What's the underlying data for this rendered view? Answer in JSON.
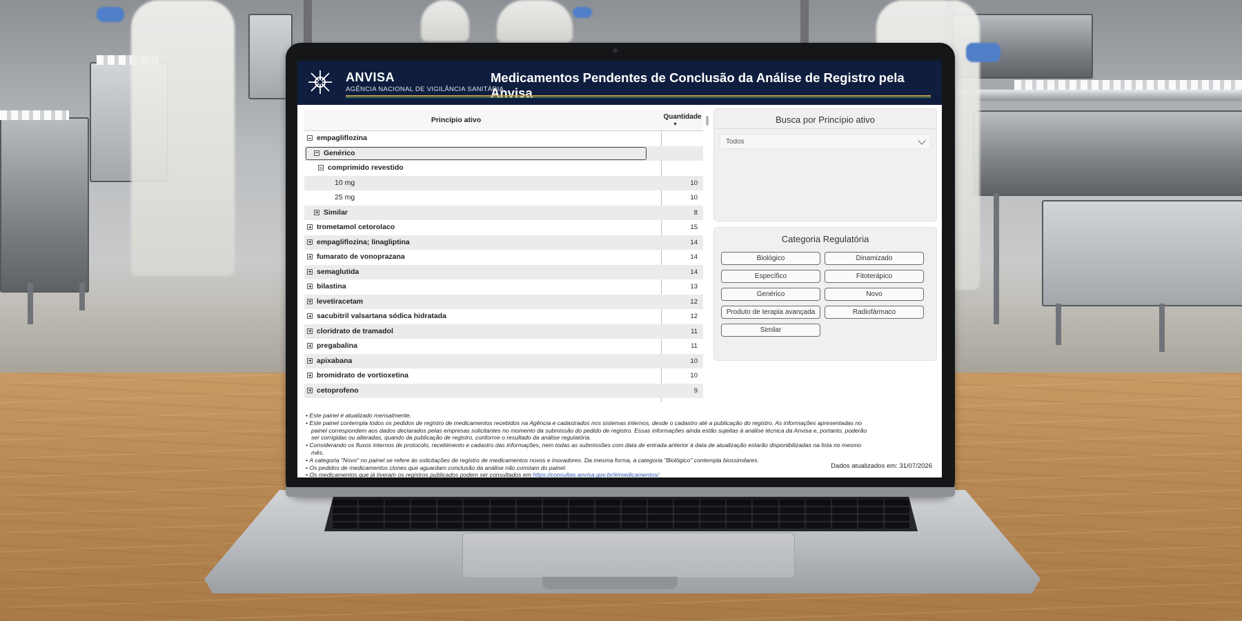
{
  "header": {
    "brand": "ANVISA",
    "agency": "AGÊNCIA NACIONAL DE VIGILÂNCIA SANITÁRIA",
    "title": "Medicamentos Pendentes de Conclusão da Análise de Registro pela Anvisa"
  },
  "table": {
    "col_principio": "Princípio ativo",
    "col_quantidade": "Quantidade",
    "rows": [
      {
        "label": "empagliflozina",
        "qty": "",
        "level": 0,
        "toggle": "minus",
        "bold": true
      },
      {
        "label": "Genérico",
        "qty": "",
        "level": 1,
        "toggle": "minus",
        "bold": true,
        "selected": true
      },
      {
        "label": "comprimido revestido",
        "qty": "",
        "level": 2,
        "toggle": "minus",
        "bold": true
      },
      {
        "label": "10 mg",
        "qty": "10",
        "level": 3,
        "toggle": "",
        "bold": false
      },
      {
        "label": "25 mg",
        "qty": "10",
        "level": 3,
        "toggle": "",
        "bold": false
      },
      {
        "label": "Similar",
        "qty": "8",
        "level": 1,
        "toggle": "plus",
        "bold": true
      },
      {
        "label": "trometamol cetorolaco",
        "qty": "15",
        "level": 0,
        "toggle": "plus",
        "bold": true
      },
      {
        "label": "empagliflozina; linagliptina",
        "qty": "14",
        "level": 0,
        "toggle": "plus",
        "bold": true
      },
      {
        "label": "fumarato de vonoprazana",
        "qty": "14",
        "level": 0,
        "toggle": "plus",
        "bold": true
      },
      {
        "label": "semaglutida",
        "qty": "14",
        "level": 0,
        "toggle": "plus",
        "bold": true
      },
      {
        "label": "bilastina",
        "qty": "13",
        "level": 0,
        "toggle": "plus",
        "bold": true
      },
      {
        "label": "levetiracetam",
        "qty": "12",
        "level": 0,
        "toggle": "plus",
        "bold": true
      },
      {
        "label": "sacubitril valsartana sódica hidratada",
        "qty": "12",
        "level": 0,
        "toggle": "plus",
        "bold": true
      },
      {
        "label": "cloridrato de tramadol",
        "qty": "11",
        "level": 0,
        "toggle": "plus",
        "bold": true
      },
      {
        "label": "pregabalina",
        "qty": "11",
        "level": 0,
        "toggle": "plus",
        "bold": true
      },
      {
        "label": "apixabana",
        "qty": "10",
        "level": 0,
        "toggle": "plus",
        "bold": true
      },
      {
        "label": "bromidrato de vortioxetina",
        "qty": "10",
        "level": 0,
        "toggle": "plus",
        "bold": true
      },
      {
        "label": "cetoprofeno",
        "qty": "9",
        "level": 0,
        "toggle": "plus",
        "bold": true
      }
    ]
  },
  "search": {
    "title": "Busca por Princípio ativo",
    "selected": "Todos"
  },
  "categories": {
    "title": "Categoria Regulatória",
    "buttons": [
      "Biológico",
      "Dinamizado",
      "Específico",
      "Fitoterápico",
      "Genérico",
      "Novo",
      "Produto de terapia avançada",
      "Radiofármaco",
      "Similar"
    ]
  },
  "notes": [
    "Este painel é atualizado mensalmente.",
    "Este painel contempla todos os pedidos de registro de medicamentos recebidos na Agência e cadastrados nos sistemas internos, desde o cadastro até a publicação do registro. As informações apresentadas no painel correspondem aos dados declarados pelas empresas solicitantes no momento da submissão do pedido de registro. Essas informações ainda estão sujeitas à análise técnica da Anvisa e, portanto, poderão ser corrigidas ou alteradas, quando da publicação de registro, conforme o resultado da análise regulatória.",
    "Considerando os fluxos internos de protocolo, recebimento e cadastro das informações, nem todas as submissões com data de entrada anterior à data de atualização estarão disponibilizadas na lista no mesmo mês.",
    "A categoria \"Novo\" no painel se refere às solicitações de registro de medicamentos novos e inovadores. Da mesma forma, a categoria \"Biológico\" contempla biossimilares.",
    "Os pedidos de medicamentos clones que aguardam conclusão da análise não constam do painel."
  ],
  "last_note_prefix": "Os medicamentos que já tiveram os registros publicados podem ser consultados em ",
  "last_note_link": "https://consultas.anvisa.gov.br/#/medicamentos/",
  "updated": "Dados atualizados em: 31/07/2026",
  "colors": {
    "header_bg": "#0f1d3e",
    "accent_gold": "#c4a24c",
    "link": "#2b4fa8"
  },
  "icons": [
    "anvisa-logo-icon",
    "expand-minus-icon",
    "expand-plus-icon",
    "sort-desc-icon",
    "chevron-down-icon"
  ]
}
